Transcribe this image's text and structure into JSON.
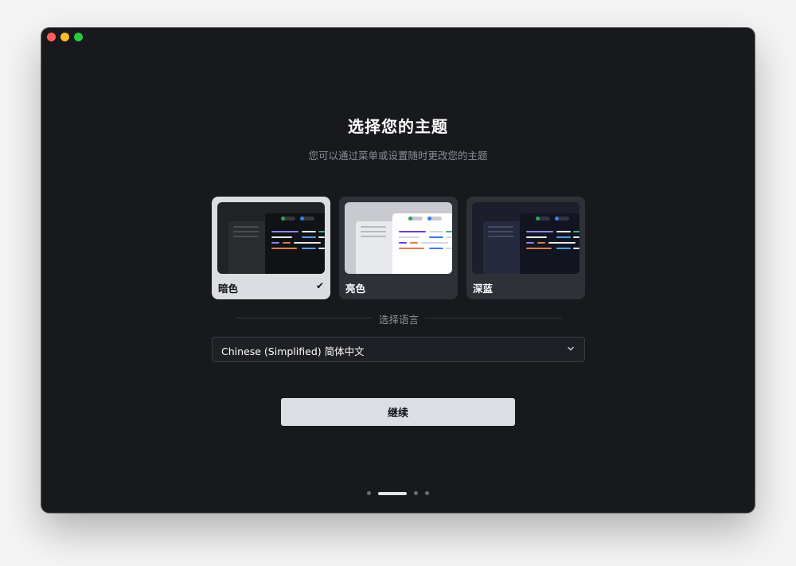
{
  "onboarding": {
    "title": "选择您的主题",
    "subtitle": "您可以通过菜单或设置随时更改您的主题",
    "themes": [
      {
        "label": "暗色",
        "selected": true
      },
      {
        "label": "亮色",
        "selected": false
      },
      {
        "label": "深蓝",
        "selected": false
      }
    ],
    "check_icon": "check-icon",
    "language_section_label": "选择语言",
    "language_value": "Chinese (Simplified) 简体中文",
    "continue_label": "继续",
    "pager": {
      "total": 4,
      "active_index": 1
    }
  },
  "colors": {
    "window_bg": "#18191d",
    "selected_card": "#dcdde3",
    "card_bg": "#2f3138",
    "button_bg": "#dcdee6"
  }
}
